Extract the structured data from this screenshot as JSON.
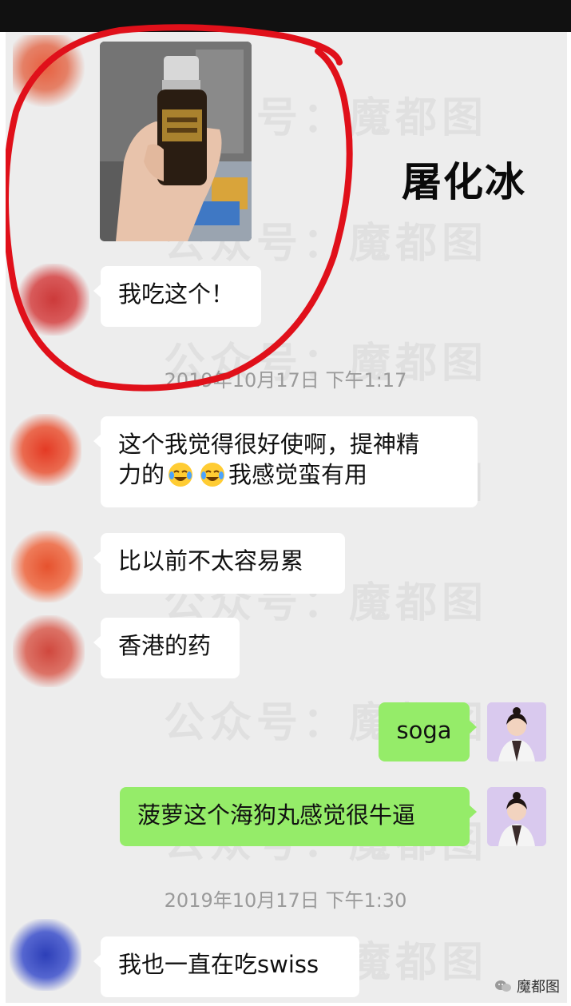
{
  "overlay": {
    "caption": "屠化冰"
  },
  "watermark": {
    "text": "公众号：魔都图"
  },
  "messages": {
    "m1": "我吃这个！",
    "ts1": "2019年10月17日 下午1:17",
    "m2_line1": "这个我觉得很好使啊，提神精",
    "m2_line2_a": "力的",
    "m2_line2_b": "我感觉蛮有用",
    "m3": "比以前不太容易累",
    "m4": "香港的药",
    "m5": "soga",
    "m6": "菠萝这个海狗丸感觉很牛逼",
    "ts2": "2019年10月17日 下午1:30",
    "m7": "我也一直在吃swiss"
  },
  "emoji": {
    "name": "face-with-tears-of-joy-icon"
  },
  "brand": {
    "label": "魔都图"
  },
  "colors": {
    "my_bubble": "#95ec69",
    "their_bubble": "#ffffff",
    "chat_bg": "#ededed",
    "annotation": "#e0101a"
  }
}
